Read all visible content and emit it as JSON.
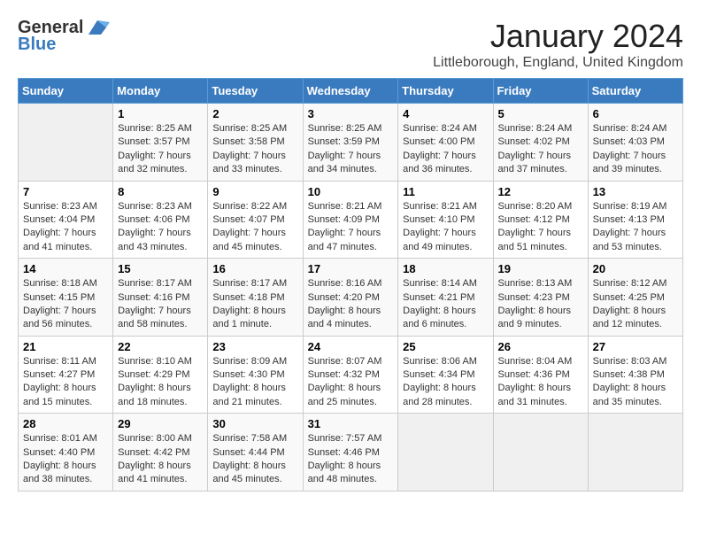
{
  "app": {
    "name_general": "General",
    "name_blue": "Blue"
  },
  "header": {
    "title": "January 2024",
    "subtitle": "Littleborough, England, United Kingdom"
  },
  "calendar": {
    "days_of_week": [
      "Sunday",
      "Monday",
      "Tuesday",
      "Wednesday",
      "Thursday",
      "Friday",
      "Saturday"
    ],
    "weeks": [
      [
        {
          "day": "",
          "info": ""
        },
        {
          "day": "1",
          "info": "Sunrise: 8:25 AM\nSunset: 3:57 PM\nDaylight: 7 hours\nand 32 minutes."
        },
        {
          "day": "2",
          "info": "Sunrise: 8:25 AM\nSunset: 3:58 PM\nDaylight: 7 hours\nand 33 minutes."
        },
        {
          "day": "3",
          "info": "Sunrise: 8:25 AM\nSunset: 3:59 PM\nDaylight: 7 hours\nand 34 minutes."
        },
        {
          "day": "4",
          "info": "Sunrise: 8:24 AM\nSunset: 4:00 PM\nDaylight: 7 hours\nand 36 minutes."
        },
        {
          "day": "5",
          "info": "Sunrise: 8:24 AM\nSunset: 4:02 PM\nDaylight: 7 hours\nand 37 minutes."
        },
        {
          "day": "6",
          "info": "Sunrise: 8:24 AM\nSunset: 4:03 PM\nDaylight: 7 hours\nand 39 minutes."
        }
      ],
      [
        {
          "day": "7",
          "info": "Sunrise: 8:23 AM\nSunset: 4:04 PM\nDaylight: 7 hours\nand 41 minutes."
        },
        {
          "day": "8",
          "info": "Sunrise: 8:23 AM\nSunset: 4:06 PM\nDaylight: 7 hours\nand 43 minutes."
        },
        {
          "day": "9",
          "info": "Sunrise: 8:22 AM\nSunset: 4:07 PM\nDaylight: 7 hours\nand 45 minutes."
        },
        {
          "day": "10",
          "info": "Sunrise: 8:21 AM\nSunset: 4:09 PM\nDaylight: 7 hours\nand 47 minutes."
        },
        {
          "day": "11",
          "info": "Sunrise: 8:21 AM\nSunset: 4:10 PM\nDaylight: 7 hours\nand 49 minutes."
        },
        {
          "day": "12",
          "info": "Sunrise: 8:20 AM\nSunset: 4:12 PM\nDaylight: 7 hours\nand 51 minutes."
        },
        {
          "day": "13",
          "info": "Sunrise: 8:19 AM\nSunset: 4:13 PM\nDaylight: 7 hours\nand 53 minutes."
        }
      ],
      [
        {
          "day": "14",
          "info": "Sunrise: 8:18 AM\nSunset: 4:15 PM\nDaylight: 7 hours\nand 56 minutes."
        },
        {
          "day": "15",
          "info": "Sunrise: 8:17 AM\nSunset: 4:16 PM\nDaylight: 7 hours\nand 58 minutes."
        },
        {
          "day": "16",
          "info": "Sunrise: 8:17 AM\nSunset: 4:18 PM\nDaylight: 8 hours\nand 1 minute."
        },
        {
          "day": "17",
          "info": "Sunrise: 8:16 AM\nSunset: 4:20 PM\nDaylight: 8 hours\nand 4 minutes."
        },
        {
          "day": "18",
          "info": "Sunrise: 8:14 AM\nSunset: 4:21 PM\nDaylight: 8 hours\nand 6 minutes."
        },
        {
          "day": "19",
          "info": "Sunrise: 8:13 AM\nSunset: 4:23 PM\nDaylight: 8 hours\nand 9 minutes."
        },
        {
          "day": "20",
          "info": "Sunrise: 8:12 AM\nSunset: 4:25 PM\nDaylight: 8 hours\nand 12 minutes."
        }
      ],
      [
        {
          "day": "21",
          "info": "Sunrise: 8:11 AM\nSunset: 4:27 PM\nDaylight: 8 hours\nand 15 minutes."
        },
        {
          "day": "22",
          "info": "Sunrise: 8:10 AM\nSunset: 4:29 PM\nDaylight: 8 hours\nand 18 minutes."
        },
        {
          "day": "23",
          "info": "Sunrise: 8:09 AM\nSunset: 4:30 PM\nDaylight: 8 hours\nand 21 minutes."
        },
        {
          "day": "24",
          "info": "Sunrise: 8:07 AM\nSunset: 4:32 PM\nDaylight: 8 hours\nand 25 minutes."
        },
        {
          "day": "25",
          "info": "Sunrise: 8:06 AM\nSunset: 4:34 PM\nDaylight: 8 hours\nand 28 minutes."
        },
        {
          "day": "26",
          "info": "Sunrise: 8:04 AM\nSunset: 4:36 PM\nDaylight: 8 hours\nand 31 minutes."
        },
        {
          "day": "27",
          "info": "Sunrise: 8:03 AM\nSunset: 4:38 PM\nDaylight: 8 hours\nand 35 minutes."
        }
      ],
      [
        {
          "day": "28",
          "info": "Sunrise: 8:01 AM\nSunset: 4:40 PM\nDaylight: 8 hours\nand 38 minutes."
        },
        {
          "day": "29",
          "info": "Sunrise: 8:00 AM\nSunset: 4:42 PM\nDaylight: 8 hours\nand 41 minutes."
        },
        {
          "day": "30",
          "info": "Sunrise: 7:58 AM\nSunset: 4:44 PM\nDaylight: 8 hours\nand 45 minutes."
        },
        {
          "day": "31",
          "info": "Sunrise: 7:57 AM\nSunset: 4:46 PM\nDaylight: 8 hours\nand 48 minutes."
        },
        {
          "day": "",
          "info": ""
        },
        {
          "day": "",
          "info": ""
        },
        {
          "day": "",
          "info": ""
        }
      ]
    ]
  }
}
